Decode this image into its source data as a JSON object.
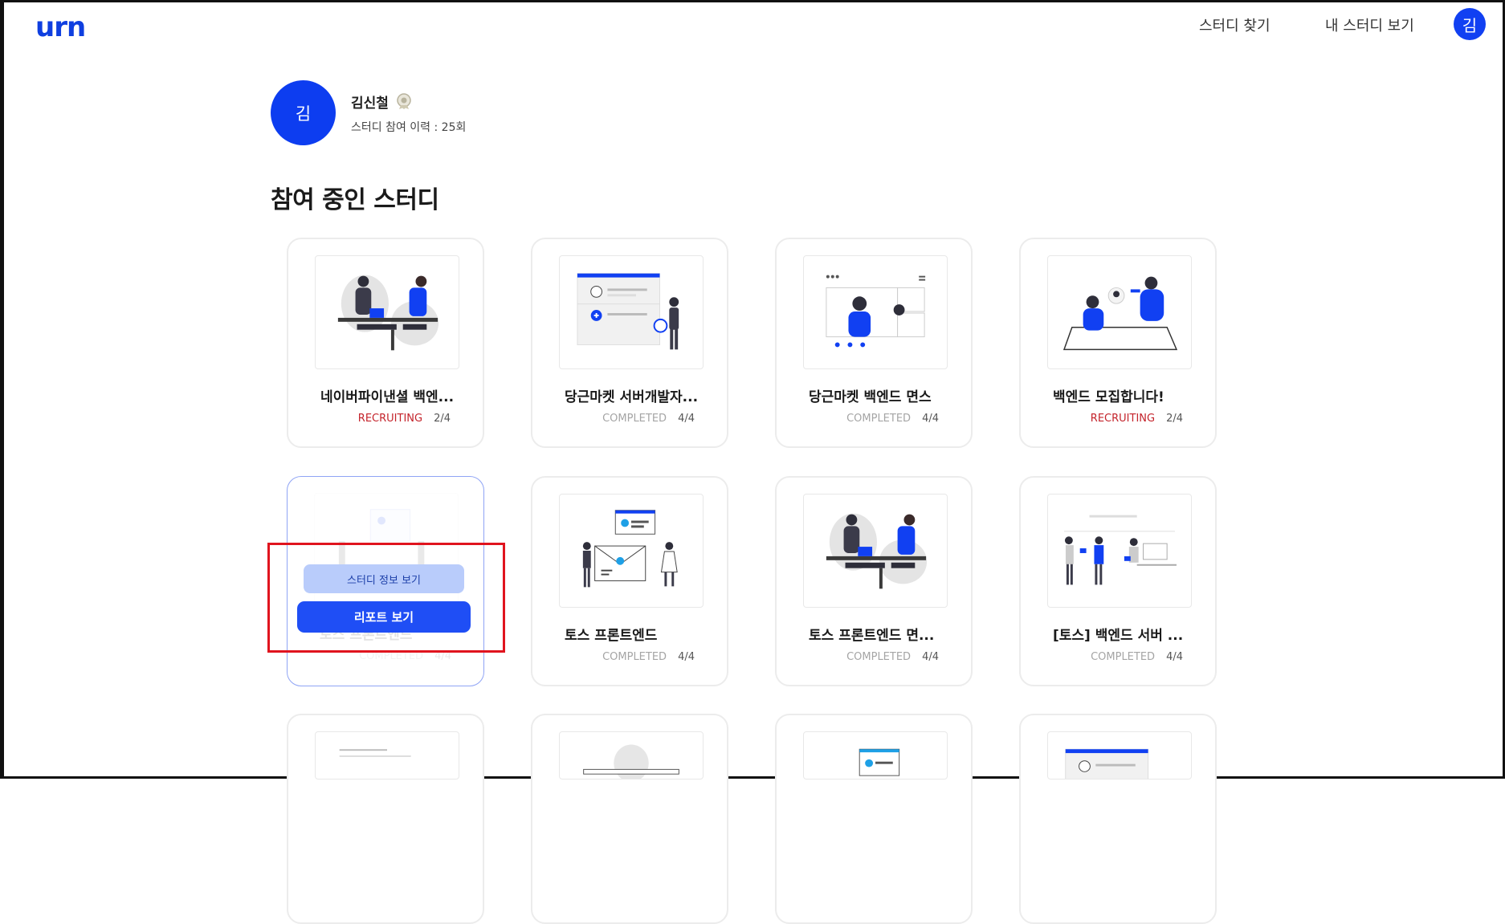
{
  "header": {
    "logo": "urn",
    "nav": {
      "find_study": "스터디 찾기",
      "my_study": "내 스터디 보기"
    },
    "avatar_initial": "김"
  },
  "profile": {
    "avatar_initial": "김",
    "name": "김신철",
    "history": "스터디 참여 이력 : 25회",
    "badge_icon": "medal-icon"
  },
  "section": {
    "title": "참여 중인 스터디"
  },
  "cards": [
    {
      "title": "네이버파이낸셜 백엔...",
      "status": "RECRUITING",
      "count": "2/4",
      "illustration": "handshake"
    },
    {
      "title": "당근마켓 서버개발자...",
      "status": "COMPLETED",
      "count": "4/4",
      "illustration": "profile-list"
    },
    {
      "title": "당근마켓 백엔드 면스",
      "status": "COMPLETED",
      "count": "4/4",
      "illustration": "video-call"
    },
    {
      "title": "백엔드 모집합니다!",
      "status": "RECRUITING",
      "count": "2/4",
      "illustration": "meeting"
    },
    {
      "title": "토스 프론트엔드",
      "status": "COMPLETED",
      "count": "4/4",
      "illustration": "board"
    },
    {
      "title": "토스 프론트엔드",
      "status": "COMPLETED",
      "count": "4/4",
      "illustration": "envelope"
    },
    {
      "title": "토스 프론트엔드 면...",
      "status": "COMPLETED",
      "count": "4/4",
      "illustration": "handshake"
    },
    {
      "title": "[토스] 백엔드 서버 ...",
      "status": "COMPLETED",
      "count": "4/4",
      "illustration": "team"
    }
  ],
  "hover_actions": {
    "info": "스터디 정보 보기",
    "report": "리포트 보기"
  },
  "colors": {
    "brand": "#1140f2",
    "recruiting": "#c4232b",
    "completed": "#a5a5a5",
    "highlight": "#e0141e"
  }
}
